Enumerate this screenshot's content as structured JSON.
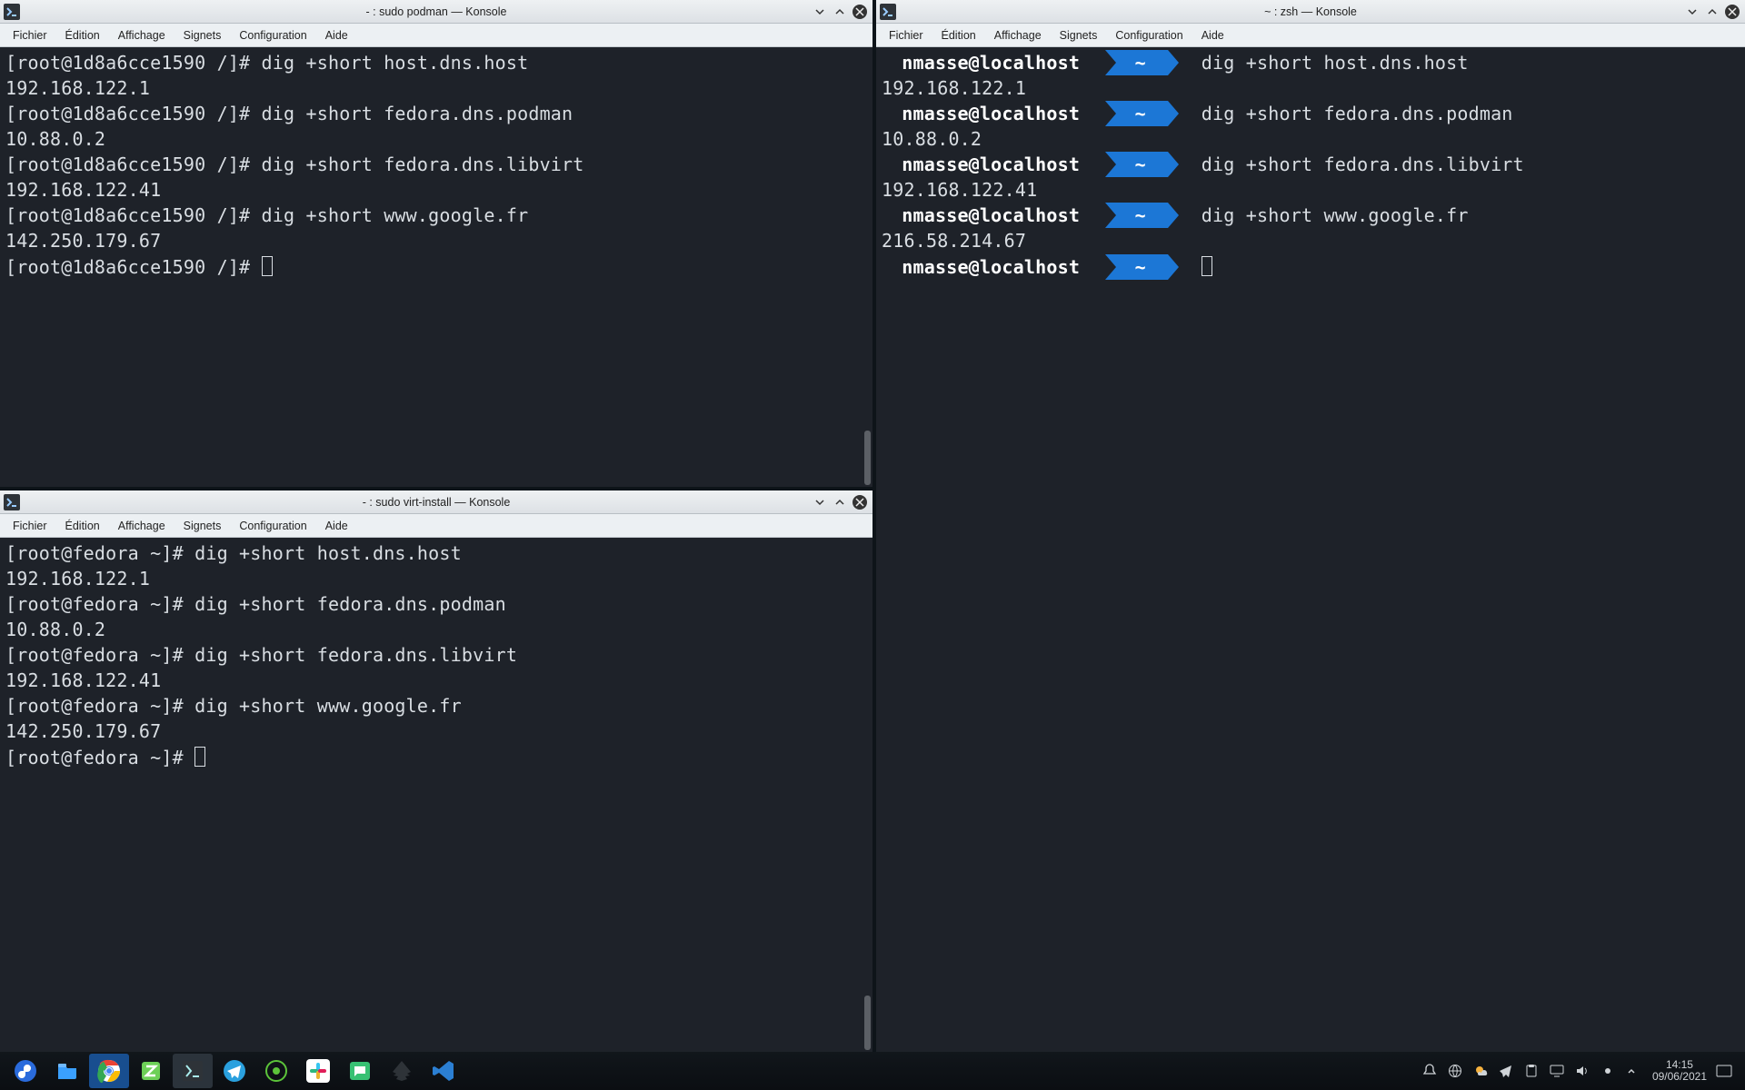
{
  "menus": {
    "file": "Fichier",
    "edit": "Édition",
    "view": "Affichage",
    "bookmarks": "Signets",
    "settings": "Configuration",
    "help": "Aide"
  },
  "windows": {
    "podman": {
      "title": "- : sudo podman — Konsole",
      "prompt": "[root@1d8a6cce1590 /]# ",
      "lines": [
        {
          "cmd": "dig +short host.dns.host",
          "out": "192.168.122.1"
        },
        {
          "cmd": "dig +short fedora.dns.podman",
          "out": "10.88.0.2"
        },
        {
          "cmd": "dig +short fedora.dns.libvirt",
          "out": "192.168.122.41"
        },
        {
          "cmd": "dig +short www.google.fr",
          "out": "142.250.179.67"
        }
      ]
    },
    "virt": {
      "title": "- : sudo virt-install — Konsole",
      "prompt": "[root@fedora ~]# ",
      "lines": [
        {
          "cmd": "dig +short host.dns.host",
          "out": "192.168.122.1"
        },
        {
          "cmd": "dig +short fedora.dns.podman",
          "out": "10.88.0.2"
        },
        {
          "cmd": "dig +short fedora.dns.libvirt",
          "out": "192.168.122.41"
        },
        {
          "cmd": "dig +short www.google.fr",
          "out": "142.250.179.67"
        }
      ]
    },
    "zsh": {
      "title": "~ : zsh — Konsole",
      "user": "nmasse@localhost",
      "cwd": "~",
      "lines": [
        {
          "cmd": "dig +short host.dns.host",
          "out": "192.168.122.1"
        },
        {
          "cmd": "dig +short fedora.dns.podman",
          "out": "10.88.0.2"
        },
        {
          "cmd": "dig +short fedora.dns.libvirt",
          "out": "192.168.122.41"
        },
        {
          "cmd": "dig +short www.google.fr",
          "out": "216.58.214.67"
        }
      ]
    }
  },
  "taskbar": {
    "clock_time": "14:15",
    "clock_date": "09/06/2021",
    "apps": [
      {
        "name": "fedora-menu",
        "color": "#2a6bdc"
      },
      {
        "name": "file-manager",
        "color": "#3aa0ff"
      },
      {
        "name": "chrome",
        "color": "#fff"
      },
      {
        "name": "zim",
        "color": "#6dd057"
      },
      {
        "name": "konsole",
        "color": "#2e3338"
      },
      {
        "name": "telegram",
        "color": "#2aa0de"
      },
      {
        "name": "spotify-alt",
        "color": "#5cc43a"
      },
      {
        "name": "slack",
        "color": "#fff"
      },
      {
        "name": "chat",
        "color": "#37c173"
      },
      {
        "name": "inkscape",
        "color": "#2e3338"
      },
      {
        "name": "vscode",
        "color": "#2b7fd3"
      }
    ],
    "tray": [
      "notifications-icon",
      "network-icon",
      "weather-icon",
      "telegram-tray-icon",
      "clipboard-icon",
      "display-icon",
      "volume-icon",
      "updates-icon"
    ]
  }
}
